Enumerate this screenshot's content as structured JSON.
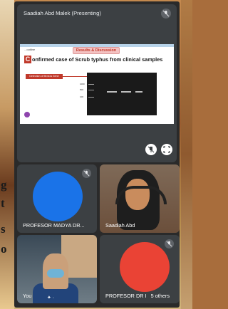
{
  "present": {
    "name": "Saadiah Abd Malek (Presenting)"
  },
  "slide": {
    "outline": "...outline",
    "heading": "Results & Discussion",
    "title_letter": "C",
    "title": "onfirmed case of Scrub typhus from clinical samples",
    "detect_label": "Detection of 56 kDa Gene",
    "ladder_labels": [
      "1000",
      "500",
      "100"
    ]
  },
  "tiles": [
    {
      "name": "PROFESOR MADYA DR...",
      "avatar_color": "#1a73e8"
    },
    {
      "name": "Saadiah Abd"
    },
    {
      "name": "You"
    },
    {
      "name": "PROFESOR DR I",
      "extra": "5 others",
      "avatar_color": "#ea4335"
    }
  ],
  "icons": {
    "mic_off": "mic-off-icon",
    "pin": "pin-icon",
    "fullscreen": "fullscreen-icon"
  }
}
